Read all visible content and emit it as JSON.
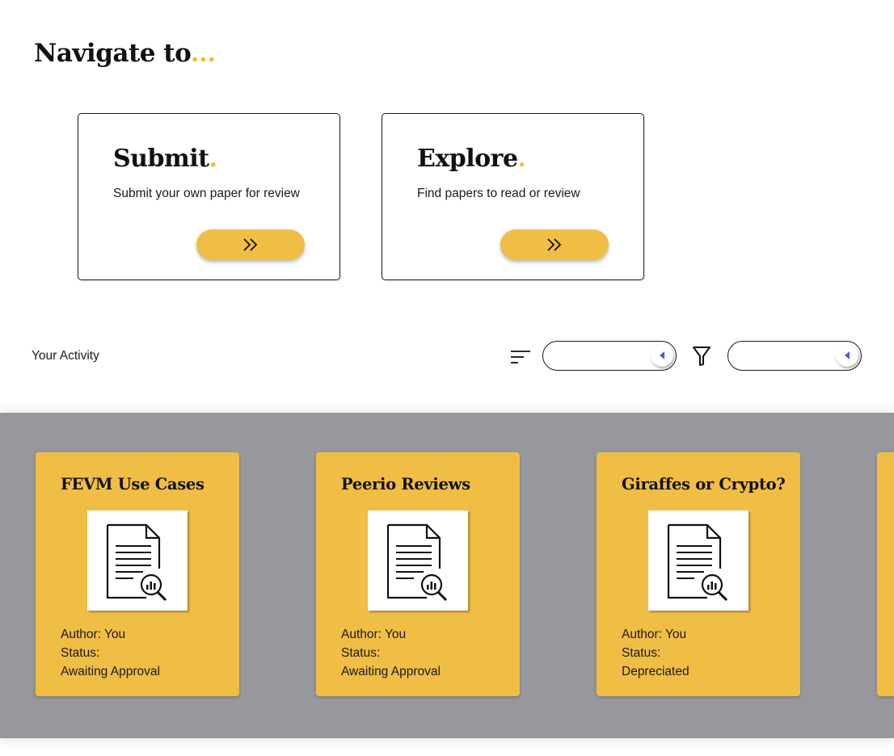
{
  "title": {
    "text": "Navigate to",
    "suffix": "..."
  },
  "nav_cards": [
    {
      "title": "Submit",
      "dot": ".",
      "description": "Submit your own paper for review",
      "button_icon": "double-chevron-right-icon"
    },
    {
      "title": "Explore",
      "dot": ".",
      "description": "Find papers to read or review",
      "button_icon": "double-chevron-right-icon"
    }
  ],
  "activity": {
    "label": "Your Activity",
    "sort_icon": "sort-lines-icon",
    "filter_icon": "funnel-icon",
    "sort_select": {
      "value": ""
    },
    "filter_select": {
      "value": ""
    }
  },
  "papers": [
    {
      "title": "FEVM Use Cases",
      "author": "Author: You",
      "status_label": "Status:",
      "status": "Awaiting Approval",
      "icon": "document-analytics-icon"
    },
    {
      "title": "Peerio Reviews",
      "author": "Author: You",
      "status_label": "Status:",
      "status": "Awaiting Approval",
      "icon": "document-analytics-icon"
    },
    {
      "title": "Giraffes or Crypto?",
      "author": "Author: You",
      "status_label": "Status:",
      "status": "Depreciated",
      "icon": "document-analytics-icon"
    },
    {
      "title": "",
      "author": "",
      "status_label": "",
      "status": ""
    }
  ],
  "colors": {
    "accent": "#f0bd45",
    "strip": "#97989d",
    "select_arrow": "#4a5ae8"
  }
}
